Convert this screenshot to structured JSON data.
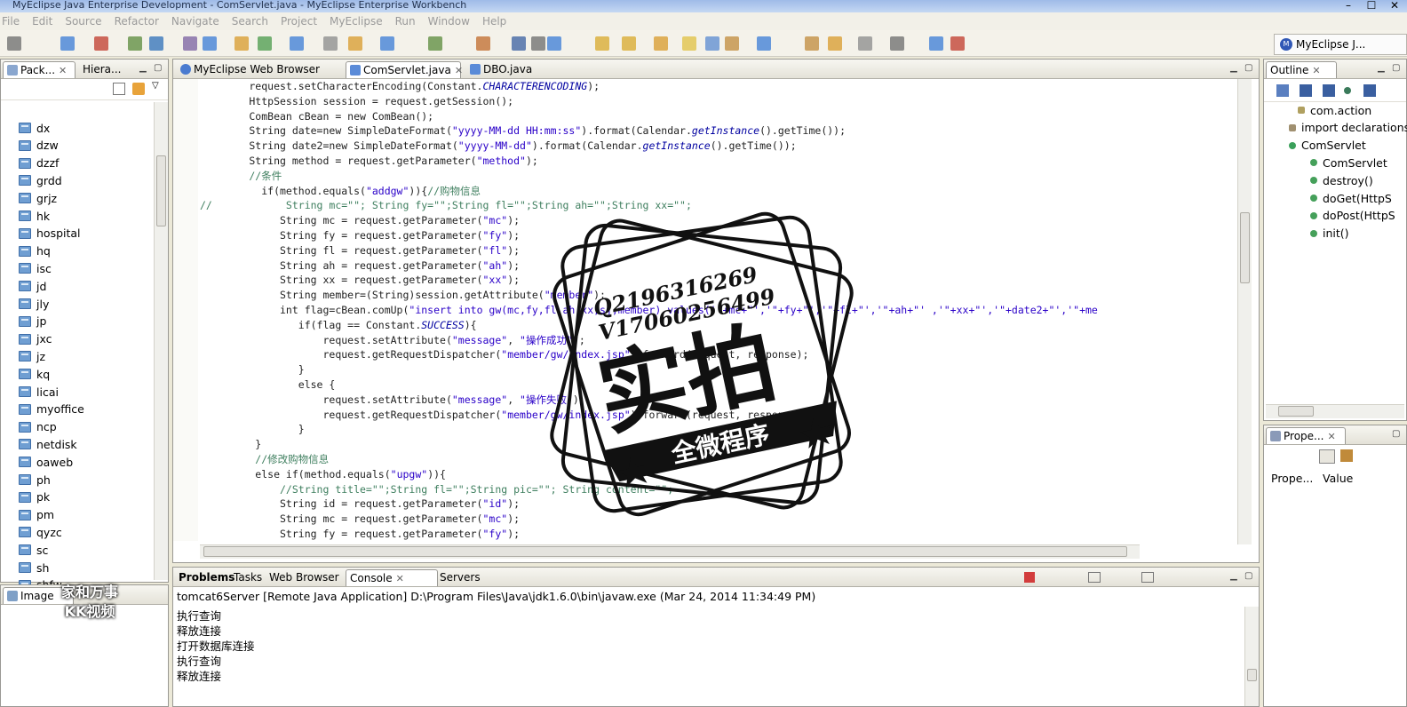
{
  "window": {
    "title": "MyEclipse Java Enterprise Development - ComServlet.java - MyEclipse Enterprise Workbench"
  },
  "menu": [
    "File",
    "Edit",
    "Source",
    "Refactor",
    "Navigate",
    "Search",
    "Project",
    "MyEclipse",
    "Run",
    "Window",
    "Help"
  ],
  "perspective": {
    "label": "MyEclipse J..."
  },
  "left_panel": {
    "tabs": [
      "Pack...",
      "Hiera..."
    ],
    "items": [
      "dx",
      "dzw",
      "dzzf",
      "grdd",
      "grjz",
      "hk",
      "hospital",
      "hq",
      "isc",
      "jd",
      "jly",
      "jp",
      "jxc",
      "jz",
      "kq",
      "licai",
      "myoffice",
      "ncp",
      "netdisk",
      "oaweb",
      "ph",
      "pk",
      "pm",
      "qyzc",
      "sc",
      "sh",
      "shfw"
    ]
  },
  "bottom_left": {
    "tabs": [
      "Image"
    ]
  },
  "editor": {
    "tabs": [
      "MyEclipse Web Browser",
      "ComServlet.java",
      "DBO.java"
    ],
    "lines": [
      [
        {
          "t": "        request.setCharacterEncoding(Constant."
        },
        {
          "t": "CHARACTERENCODING",
          "c": "i"
        },
        {
          "t": ");"
        }
      ],
      [
        {
          "t": "        HttpSession session = request.getSession();"
        }
      ],
      [
        {
          "t": "        ComBean cBean = new ComBean();"
        }
      ],
      [
        {
          "t": "        String date=new SimpleDateFormat("
        },
        {
          "t": "\"yyyy-MM-dd HH:mm:ss\"",
          "c": "s"
        },
        {
          "t": ").format(Calendar."
        },
        {
          "t": "getInstance",
          "c": "i"
        },
        {
          "t": "().getTime());"
        }
      ],
      [
        {
          "t": "        String date2=new SimpleDateFormat("
        },
        {
          "t": "\"yyyy-MM-dd\"",
          "c": "s"
        },
        {
          "t": ").format(Calendar."
        },
        {
          "t": "getInstance",
          "c": "i"
        },
        {
          "t": "().getTime());"
        }
      ],
      [
        {
          "t": "        String method = request.getParameter("
        },
        {
          "t": "\"method\"",
          "c": "s"
        },
        {
          "t": ");"
        }
      ],
      [
        {
          "t": "        //条件",
          "c": "c"
        }
      ],
      [
        {
          "t": "          if(method.equals("
        },
        {
          "t": "\"addgw\"",
          "c": "s"
        },
        {
          "t": ")){"
        },
        {
          "t": "//购物信息",
          "c": "c"
        }
      ],
      [
        {
          "t": "//            String mc=\"\"; String fy=\"\";String fl=\"\";String ah=\"\";String xx=\"\";",
          "c": "c"
        }
      ],
      [
        {
          "t": "             String mc = request.getParameter("
        },
        {
          "t": "\"mc\"",
          "c": "s"
        },
        {
          "t": ");"
        }
      ],
      [
        {
          "t": "             String fy = request.getParameter("
        },
        {
          "t": "\"fy\"",
          "c": "s"
        },
        {
          "t": ");"
        }
      ],
      [
        {
          "t": "             String fl = request.getParameter("
        },
        {
          "t": "\"fl\"",
          "c": "s"
        },
        {
          "t": ");"
        }
      ],
      [
        {
          "t": "             String ah = request.getParameter("
        },
        {
          "t": "\"ah\"",
          "c": "s"
        },
        {
          "t": ");"
        }
      ],
      [
        {
          "t": "             String xx = request.getParameter("
        },
        {
          "t": "\"xx\"",
          "c": "s"
        },
        {
          "t": ");"
        }
      ],
      [
        {
          "t": "             String member=(String)session.getAttribute("
        },
        {
          "t": "\"member\"",
          "c": "s"
        },
        {
          "t": ");"
        }
      ],
      [
        {
          "t": "             int flag=cBean.comUp("
        },
        {
          "t": "\"insert into gw(mc,fy,fl,ah,xx,sj,member) values('\"+mc+\"','\"+fy+\"','\"+fl+\"','\"+ah+\"' ,'\"+xx+\"','\"+date2+\"','\"+me",
          "c": "s"
        }
      ],
      [
        {
          "t": "                if(flag == Constant."
        },
        {
          "t": "SUCCESS",
          "c": "i"
        },
        {
          "t": "){"
        }
      ],
      [
        {
          "t": "                    request.setAttribute("
        },
        {
          "t": "\"message\"",
          "c": "s"
        },
        {
          "t": ", "
        },
        {
          "t": "\"操作成功\"",
          "c": "s"
        },
        {
          "t": ");"
        }
      ],
      [
        {
          "t": "                    request.getRequestDispatcher("
        },
        {
          "t": "\"member/gw/index.jsp\"",
          "c": "s"
        },
        {
          "t": ").forward(request, response);"
        }
      ],
      [
        {
          "t": "                }"
        }
      ],
      [
        {
          "t": "                else {"
        }
      ],
      [
        {
          "t": "                    request.setAttribute("
        },
        {
          "t": "\"message\"",
          "c": "s"
        },
        {
          "t": ", "
        },
        {
          "t": "\"操作失败\"",
          "c": "s"
        },
        {
          "t": ");"
        }
      ],
      [
        {
          "t": "                    request.getRequestDispatcher("
        },
        {
          "t": "\"member/gw/index.jsp\"",
          "c": "s"
        },
        {
          "t": ").forward(request, response);"
        }
      ],
      [
        {
          "t": "                }"
        }
      ],
      [
        {
          "t": "         }"
        }
      ],
      [
        {
          "t": "         //修改购物信息",
          "c": "c"
        }
      ],
      [
        {
          "t": "         else if(method.equals("
        },
        {
          "t": "\"upgw\"",
          "c": "s"
        },
        {
          "t": ")){"
        }
      ],
      [
        {
          "t": "             //String title=\"\";String fl=\"\";String pic=\"\"; String content=\"\";",
          "c": "c"
        }
      ],
      [
        {
          "t": "             String id = request.getParameter("
        },
        {
          "t": "\"id\"",
          "c": "s"
        },
        {
          "t": ");"
        }
      ],
      [
        {
          "t": "             String mc = request.getParameter("
        },
        {
          "t": "\"mc\"",
          "c": "s"
        },
        {
          "t": ");"
        }
      ],
      [
        {
          "t": "             String fy = request.getParameter("
        },
        {
          "t": "\"fy\"",
          "c": "s"
        },
        {
          "t": ");"
        }
      ]
    ]
  },
  "outline": {
    "tab": "Outline",
    "items": [
      "com.action",
      "import declarations",
      "ComServlet",
      "ComServlet",
      "destroy()",
      "doGet(HttpS",
      "doPost(HttpS",
      "init()"
    ]
  },
  "properties": {
    "tab": "Prope...",
    "col1": "Prope...",
    "col2": "Value"
  },
  "console": {
    "tabs": [
      "Problems",
      "Tasks",
      "Web Browser",
      "Console",
      "Servers"
    ],
    "header": "tomcat6Server [Remote Java Application] D:\\Program Files\\Java\\jdk1.6.0\\bin\\javaw.exe (Mar 24, 2014 11:34:49 PM)",
    "lines": [
      "执行查询",
      "释放连接",
      "打开数据库连接",
      "执行查询",
      "释放连接"
    ]
  },
  "stamp": {
    "line1": "Q2196316269",
    "line2": "V17060256499",
    "big": "实拍",
    "band": "全微程序"
  },
  "watermark": {
    "line1": "家和万事",
    "line2": "KK视频"
  },
  "colors": {
    "accent": "#3158b6",
    "folder": "#6f9ed2",
    "string": "#2a00c8",
    "comment": "#3f7f5f"
  }
}
